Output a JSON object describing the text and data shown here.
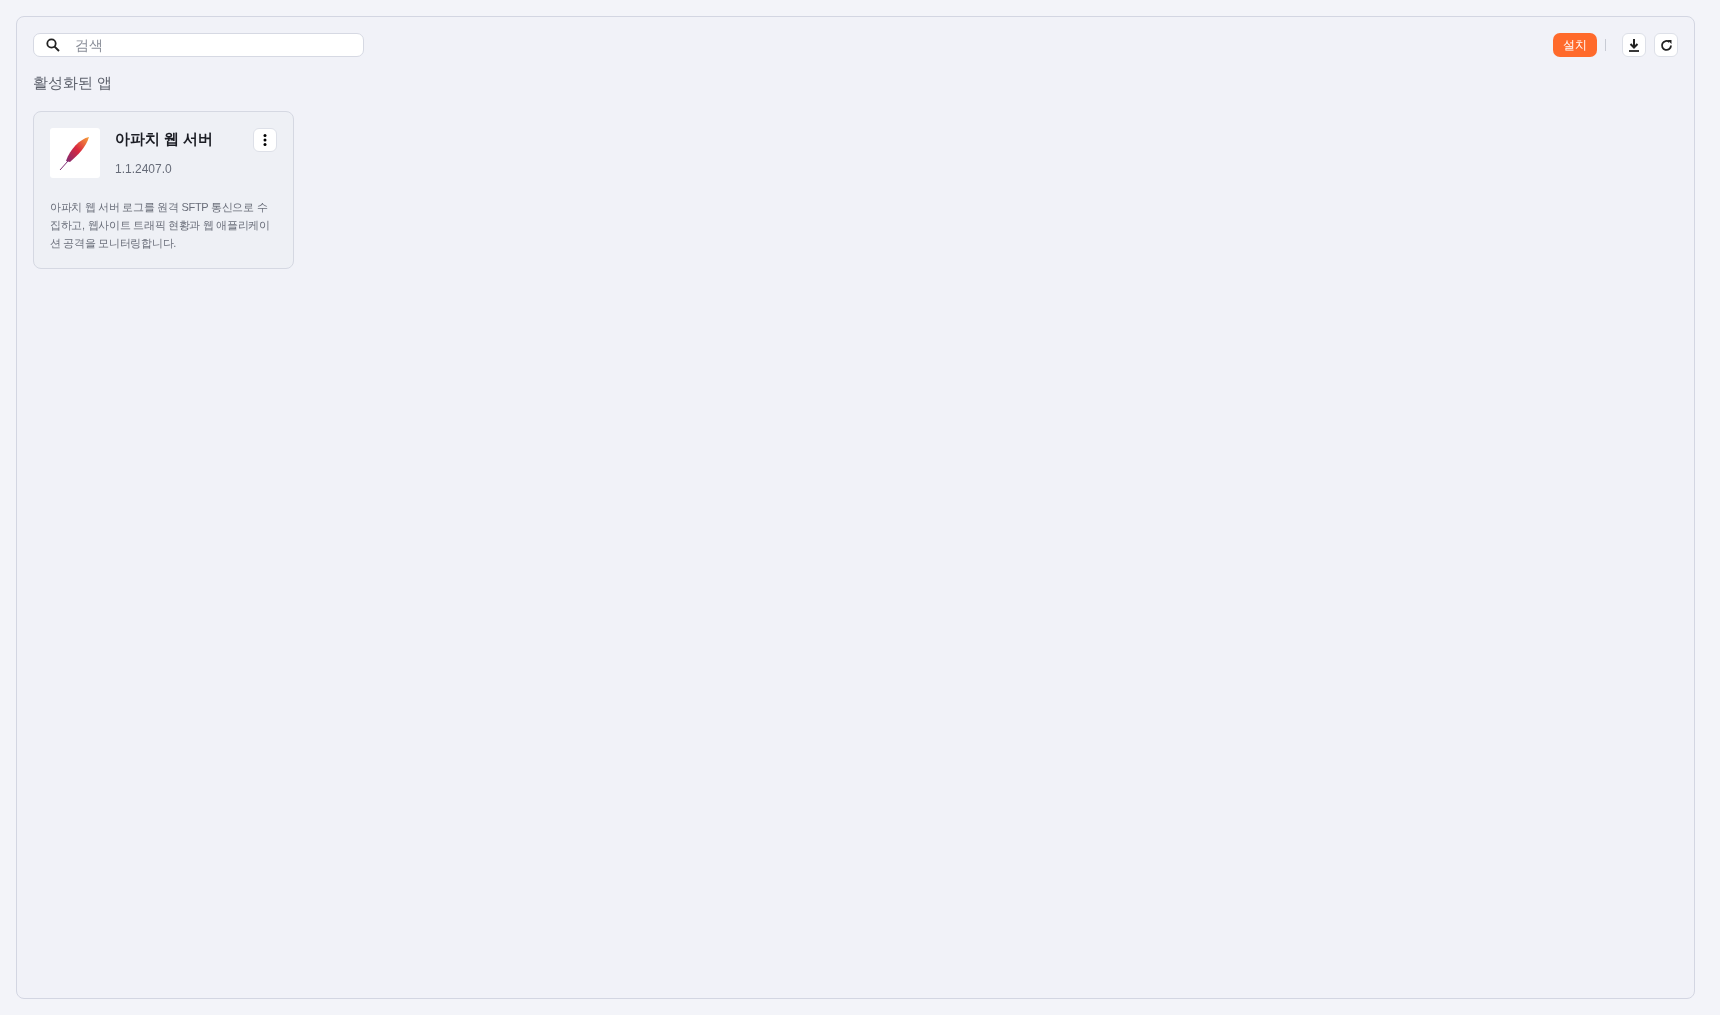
{
  "search": {
    "placeholder": "검색"
  },
  "toolbar": {
    "install_button": "설치"
  },
  "section_title": "활성화된 앱",
  "apps": [
    {
      "name": "아파치 웹 서버",
      "version": "1.1.2407.0",
      "description": "아파치 웹 서버 로그를 원격 SFTP 통신으로 수집하고, 웹사이트 트래픽 현황과 웹 애플리케이션 공격을 모니터링합니다."
    }
  ]
}
